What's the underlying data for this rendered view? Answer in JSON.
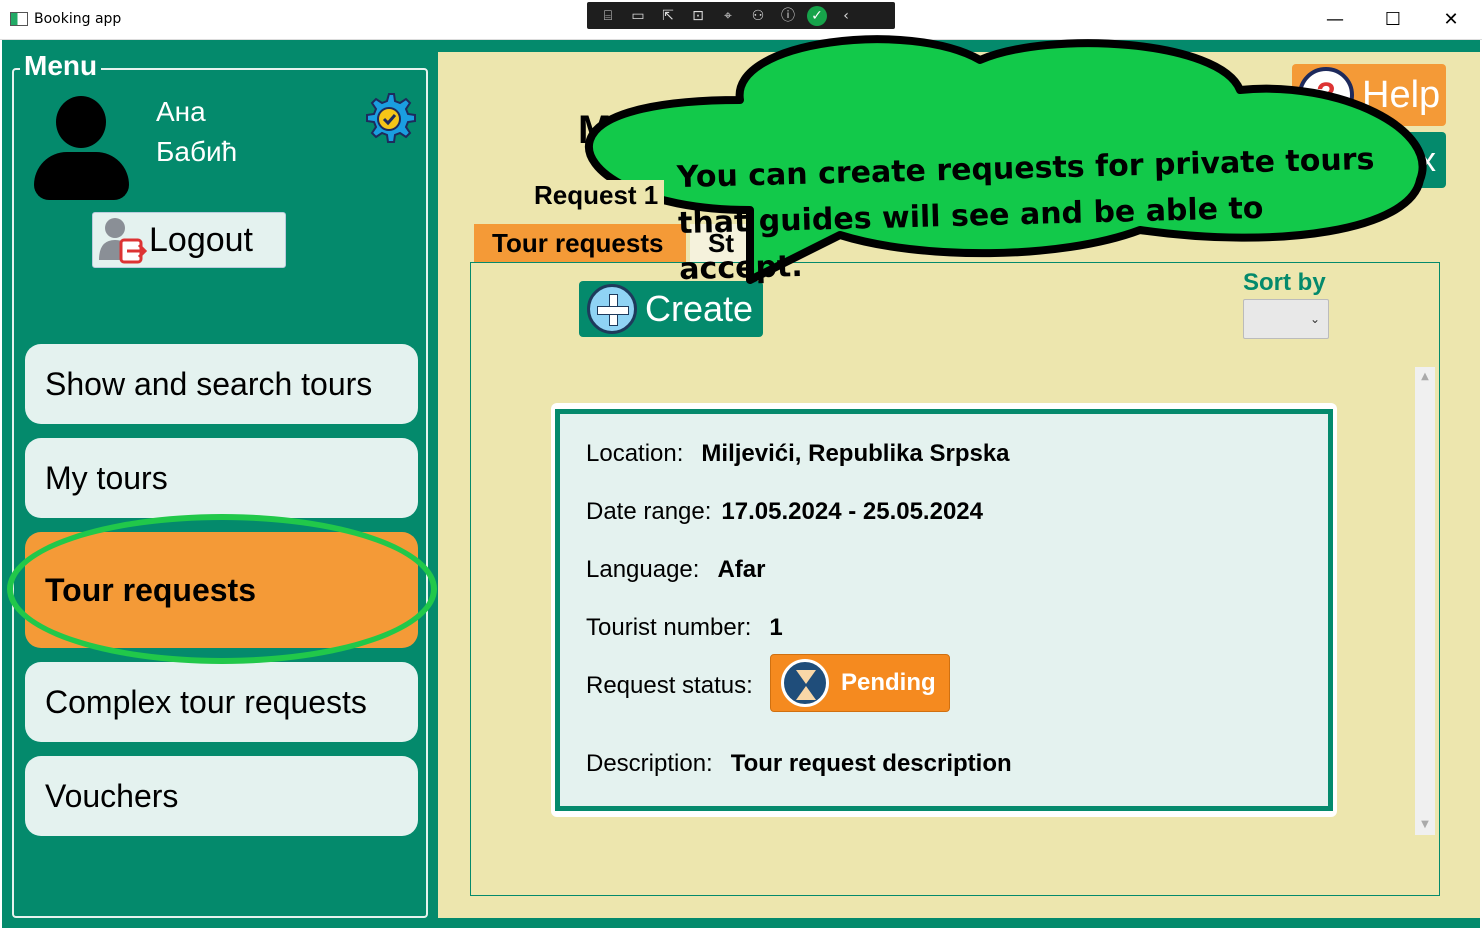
{
  "window": {
    "title": "Booking app",
    "minimize": "—",
    "maximize": "☐",
    "close": "✕"
  },
  "debug_toolbar": {
    "items": [
      "⌸",
      "▭",
      "⇱",
      "⊡",
      "⌖",
      "⚇",
      "ⓘ",
      "✓",
      "‹"
    ]
  },
  "menu": {
    "label": "Menu",
    "user_name": "Ана\nБабић",
    "logout_label": "Logout",
    "items": [
      {
        "label": "Show and search tours"
      },
      {
        "label": "My tours"
      },
      {
        "label": "Tour requests",
        "active": true
      },
      {
        "label": "Complex tour requests"
      },
      {
        "label": "Vouchers"
      }
    ]
  },
  "main": {
    "title_partial": "M",
    "help_label": "Help",
    "inbox_partial": "ox",
    "tabs": [
      {
        "label": "Tour requests",
        "active": true
      },
      {
        "label": "St",
        "active": false
      }
    ],
    "create_label": "Create",
    "sort_label": "Sort by",
    "sort_value": "⌄"
  },
  "request": {
    "title": "Request 1",
    "location_label": "Location:",
    "location_value": "Miljevići, Republika Srpska",
    "date_label": "Date range:",
    "date_value": "17.05.2024 - 25.05.2024",
    "language_label": "Language:",
    "language_value": "Afar",
    "tourists_label": "Tourist number:",
    "tourists_value": "1",
    "status_label": "Request status:",
    "status_value": "Pending",
    "description_label": "Description:",
    "description_value": "Tour request description"
  },
  "tooltip": {
    "line1": "You can create requests for private tours",
    "line2": "that guides will see and be able to accept."
  },
  "colors": {
    "primary": "#048a6c",
    "accent": "#f49a37",
    "panel": "#ede6ae",
    "highlight": "#21c84a",
    "bubble": "#12c94a"
  }
}
